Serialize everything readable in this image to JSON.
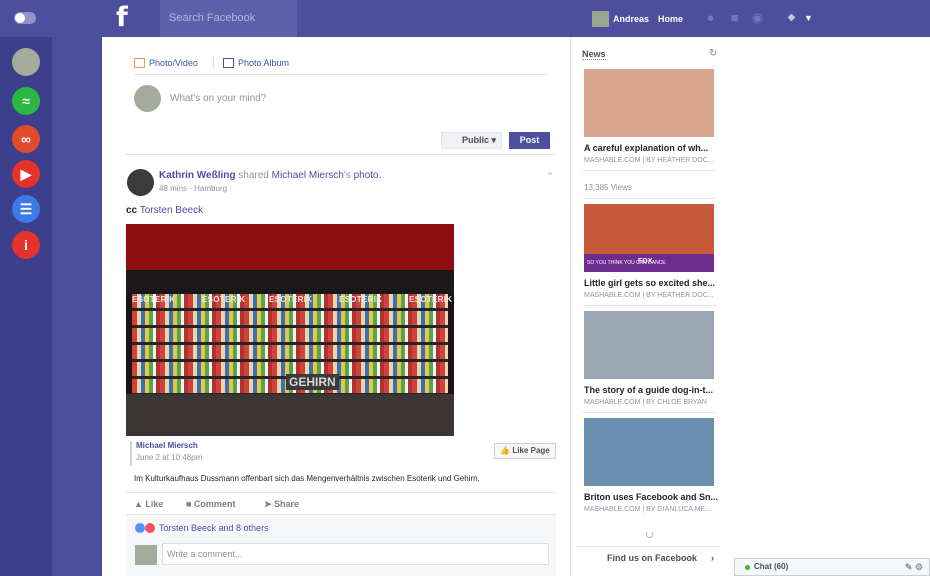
{
  "topbar": {
    "logo": "f",
    "search_placeholder": "Search Facebook",
    "user": "Andreas",
    "home": "Home"
  },
  "composer": {
    "tab_photo": "Photo/Video",
    "tab_album": "Photo Album",
    "placeholder": "What's on your mind?",
    "privacy": "Public",
    "post": "Post"
  },
  "post": {
    "author": "Kathrin Weßling",
    "shared_word": "shared",
    "shared_from": "Michael Miersch",
    "shared_suffix": "'s",
    "photo_word": "photo.",
    "time": "48 mins",
    "location": "Hamburg",
    "text_prefix": "cc",
    "tagged": "Torsten Beeck",
    "photo_labels": [
      "ESOTERIK",
      "ESOTERIK",
      "ESOTERIK",
      "ESOTERIK",
      "ESOTERIK"
    ],
    "photo_sign": "GEHIRN",
    "quote_name": "Michael Miersch",
    "quote_date": "June 2 at 10:48pm",
    "like_page": "Like Page",
    "description": "Im Kulturkaufhaus Dussmann offenbart sich das Mengenverhältnis zwischen Esoterik und Gehirn.",
    "actions": {
      "like": "Like",
      "comment": "Comment",
      "share": "Share"
    },
    "reactions_text": "Torsten Beeck and 8 others",
    "comment_placeholder": "Write a comment..."
  },
  "news": {
    "header": "News",
    "items": [
      {
        "title": "A careful explanation of wh...",
        "source": "MASHABLE.COM | BY HEATHER DOC...",
        "views": "13,385 Views",
        "color": "#d9a48e"
      },
      {
        "title": "Little girl gets so excited she...",
        "source": "MASHABLE.COM | BY HEATHER DOC...",
        "overlay": "SO YOU THINK YOU CAN DANCE",
        "badge": "FOX",
        "color": "#c8593a"
      },
      {
        "title": "The story of a guide dog-in-t...",
        "source": "MASHABLE.COM | BY CHLOE BRYAN",
        "color": "#9aa7b3"
      },
      {
        "title": "Briton uses Facebook and Sn...",
        "source": "MASHABLE.COM | BY GIANLUCA ME...",
        "color": "#6a8fae"
      }
    ],
    "find_us": "Find us on Facebook"
  },
  "chat": {
    "label": "Chat (60)"
  }
}
